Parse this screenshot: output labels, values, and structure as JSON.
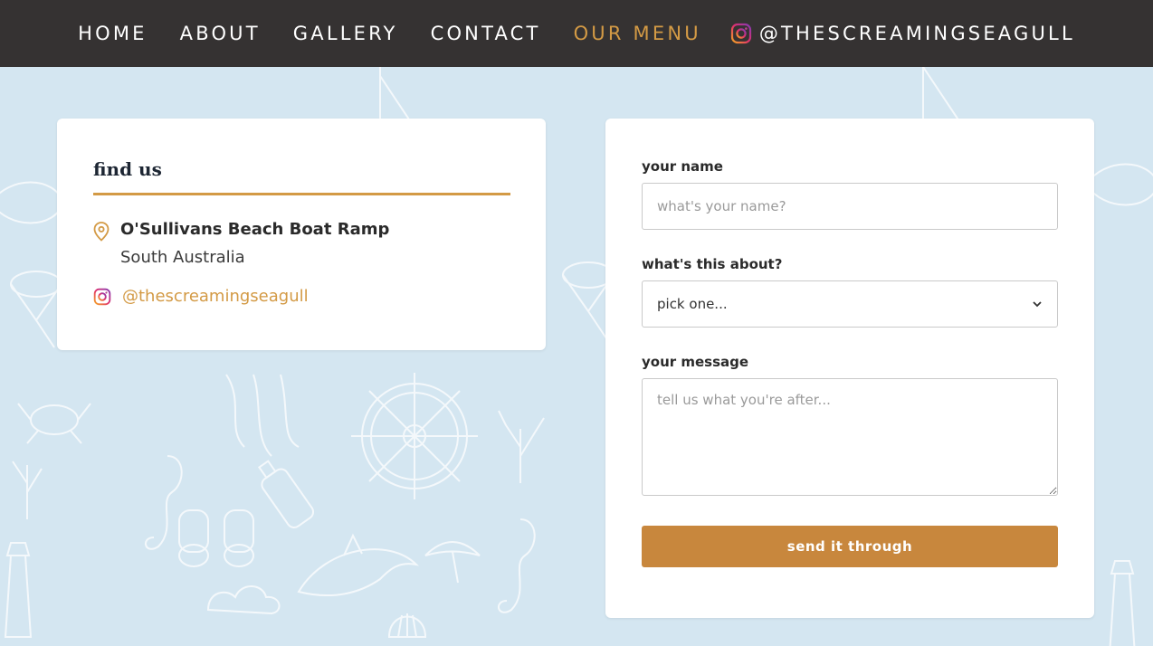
{
  "nav": {
    "items": [
      {
        "label": "HOME",
        "active": false
      },
      {
        "label": "ABOUT",
        "active": false
      },
      {
        "label": "GALLERY",
        "active": false
      },
      {
        "label": "CONTACT",
        "active": false
      },
      {
        "label": "OUR MENU",
        "active": true
      }
    ],
    "instagram_handle": "@THESCREAMINGSEAGULL",
    "instagram_icon": "instagram-icon",
    "active_color": "#d39a45",
    "bg_color": "#353232"
  },
  "find_us": {
    "title": "find us",
    "location_icon": "map-pin-icon",
    "address_name": "O'Sullivans Beach Boat Ramp",
    "address_region": "South Australia",
    "instagram_icon": "instagram-icon",
    "instagram_handle": "@thescreamingseagull"
  },
  "contact_form": {
    "name_label": "your name",
    "name_placeholder": "what's your name?",
    "topic_label": "what's this about?",
    "topic_selected": "pick one...",
    "topic_icon": "chevron-down-icon",
    "message_label": "your message",
    "message_placeholder": "tell us what you're after...",
    "submit_label": "send it through",
    "submit_color": "#c8873d"
  },
  "colors": {
    "page_bg": "#d4e6f1",
    "accent": "#d39a45"
  }
}
